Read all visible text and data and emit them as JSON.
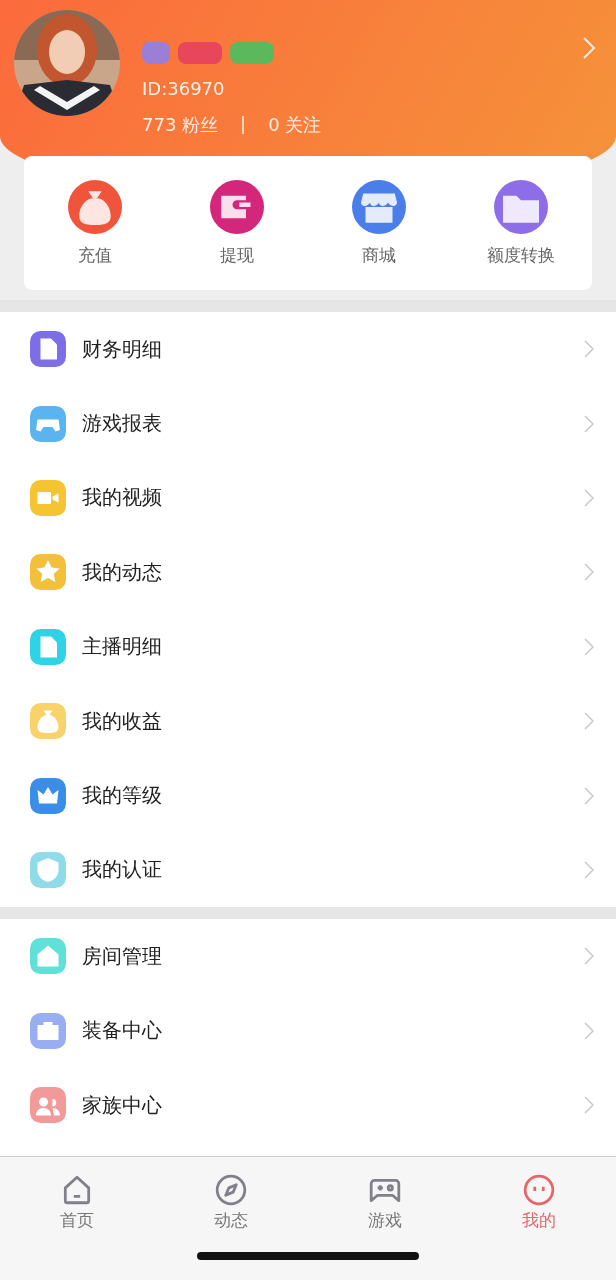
{
  "profile": {
    "badges": [
      {
        "color": "#9b7fd6"
      },
      {
        "color": "#e8465a"
      },
      {
        "color": "#5cb85c"
      }
    ],
    "id": "ID:36970",
    "fans": "773 粉丝",
    "separator": "|",
    "following": "0 关注"
  },
  "quick_actions": [
    {
      "label": "充值",
      "color": "#f0553c"
    },
    {
      "label": "提现",
      "color": "#d4267a"
    },
    {
      "label": "商城",
      "color": "#4a7ee8"
    },
    {
      "label": "额度转换",
      "color": "#8d6ee8"
    }
  ],
  "menu_groups": [
    [
      {
        "label": "财务明细",
        "color": "#7b6ee6"
      },
      {
        "label": "游戏报表",
        "color": "#5ab4f0"
      },
      {
        "label": "我的视频",
        "color": "#f5c431"
      },
      {
        "label": "我的动态",
        "color": "#f2c03a"
      },
      {
        "label": "主播明细",
        "color": "#2ed3e6"
      },
      {
        "label": "我的收益",
        "color": "#f8d36a"
      },
      {
        "label": "我的等级",
        "color": "#3a8ee8"
      },
      {
        "label": "我的认证",
        "color": "#8fdce8"
      }
    ],
    [
      {
        "label": "房间管理",
        "color": "#5fe0d8"
      },
      {
        "label": "装备中心",
        "color": "#98aef0"
      },
      {
        "label": "家族中心",
        "color": "#f29a9a"
      }
    ]
  ],
  "tabs": [
    {
      "label": "首页",
      "selected": false
    },
    {
      "label": "动态",
      "selected": false
    },
    {
      "label": "游戏",
      "selected": false
    },
    {
      "label": "我的",
      "selected": true
    }
  ]
}
